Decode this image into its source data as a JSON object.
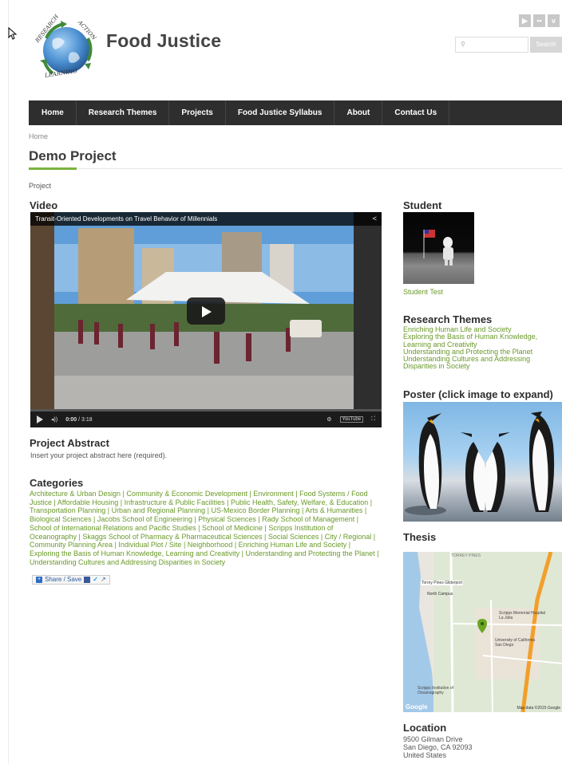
{
  "header": {
    "site_title": "Food Justice",
    "logo_words": [
      "RESEARCH",
      "ACTION",
      "LEARNING"
    ],
    "social": [
      "You Tube",
      "flickr",
      "vimeo"
    ],
    "search_placeholder": "",
    "search_button": "Search"
  },
  "nav": {
    "items": [
      {
        "label": "Home"
      },
      {
        "label": "Research Themes"
      },
      {
        "label": "Projects"
      },
      {
        "label": "Food Justice Syllabus"
      },
      {
        "label": "About"
      },
      {
        "label": "Contact Us"
      }
    ]
  },
  "breadcrumb": "Home",
  "page_title": "Demo Project",
  "content_type": "Project",
  "video": {
    "heading": "Video",
    "title": "Transit-Oriented Developments on Travel Behavior of Millennials",
    "time_current": "0:00",
    "time_total": "3:18",
    "progress": 0,
    "youtube_label": "YouTube"
  },
  "abstract": {
    "heading": "Project Abstract",
    "text": "Insert your project abstract here (required)."
  },
  "categories": {
    "heading": "Categories",
    "text": "Architecture & Urban Design | Community & Economic Development | Environment | Food Systems / Food Justice | Affordable Housing | Infrastructure & Public Facilities | Public Health, Safety, Welfare, & Education | Transportation Planning | Urban and Regional Planning | US-Mexico Border Planning | Arts & Humanities | Biological Sciences | Jacobs School of Engineering | Physical Sciences | Rady School of Management | School of International Relations and Pacific Studies | School of Medicine | Scripps Institution of Oceanography | Skaggs School of Pharmacy & Pharmaceutical Sciences | Social Sciences | City / Regional | Community Planning Area | Individual Plot / Site | Neighborhood | Enriching Human Life and Society | Exploring the Basis of Human Knowledge, Learning and Creativity | Understanding and Protecting the Planet | Understanding Cultures and Addressing Disparities in Society"
  },
  "share": {
    "label": "Share / Save"
  },
  "sidebar": {
    "student_heading": "Student",
    "student_link": "Student Test",
    "themes_heading": "Research Themes",
    "themes": [
      "Enriching Human Life and Society",
      "Exploring the Basis of Human Knowledge, Learning and Creativity",
      "Understanding and Protecting the Planet",
      "Understanding Cultures and Addressing Disparities in Society"
    ],
    "poster_heading": "Poster (click image to expand)",
    "thesis_heading": "Thesis",
    "map_labels": {
      "torrey_pines": "TORREY PINES",
      "gliderport": "Torrey Pines Gliderport",
      "north_campus": "North Campus",
      "scripps_hospital": "Scripps Memorial Hospital La Jolla",
      "ucsd": "University of California San Diego",
      "sio": "Scripps Institution of Oceanography",
      "google": "Google",
      "credit": "Map data ©2015 Google"
    },
    "location_heading": "Location",
    "address": [
      "9500 Gilman Drive",
      "San Diego, CA 92093",
      "United States"
    ]
  }
}
